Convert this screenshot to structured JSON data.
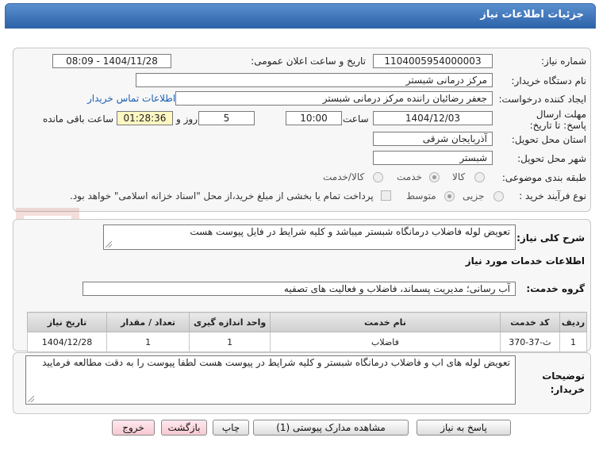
{
  "window": {
    "title": "جزئیات اطلاعات نیاز"
  },
  "form": {
    "need_number": {
      "label": "شماره نیاز:",
      "value": "1104005954000003"
    },
    "announce_datetime": {
      "label": "تاریخ و ساعت اعلان عمومی:",
      "value": "1404/11/28 - 08:09"
    },
    "buyer_org": {
      "label": "نام دستگاه خریدار:",
      "value": "مرکز درمانی شبستر"
    },
    "requester": {
      "label": "ایجاد کننده درخواست:",
      "value": "جعفر رضائیان راننده مرکز درمانی شبستر",
      "contact_link": "اطلاعات تماس خریدار"
    },
    "deadline": {
      "label": "مهلت ارسال پاسخ: تا تاریخ:",
      "date": "1404/12/03",
      "time_label": "ساعت",
      "time": "10:00",
      "days": "5",
      "days_label": "روز و",
      "remaining": "01:28:36",
      "remaining_label": "ساعت باقی مانده"
    },
    "province": {
      "label": "استان محل تحویل:",
      "value": "آذربایجان شرقی"
    },
    "city": {
      "label": "شهر محل تحویل:",
      "value": "شبستر"
    },
    "category": {
      "label": "طبقه بندی موضوعی:",
      "options": [
        "کالا",
        "خدمت",
        "کالا/خدمت"
      ],
      "selected": "خدمت"
    },
    "purchase_type": {
      "label": "نوع فرآیند خرید :",
      "options": [
        "جزیی",
        "متوسط"
      ],
      "selected": "متوسط",
      "note": "پرداخت تمام یا بخشی از مبلغ خرید،از محل \"اسناد خزانه اسلامی\" خواهد بود."
    }
  },
  "summary": {
    "label": "شرح کلی نیاز:",
    "value": "تعویض لوله فاضلاب درمانگاه شبستر میباشد و کلیه شرایط در فایل پیوست هست"
  },
  "services": {
    "section_title": "اطلاعات خدمات مورد نیاز",
    "group_label": "گروه خدمت:",
    "group_value": "آب رسانی؛ مدیریت پسماند، فاضلاب و فعالیت های تصفیه",
    "columns": [
      "ردیف",
      "کد خدمت",
      "نام خدمت",
      "واحد اندازه گیری",
      "تعداد / مقدار",
      "تاریخ نیاز"
    ],
    "rows": [
      [
        "1",
        "ث-37-370",
        "فاضلاب",
        "1",
        "1",
        "1404/12/28"
      ]
    ]
  },
  "buyer_notes": {
    "label": "توضیحات خریدار:",
    "value": "تعویض لوله های اب و فاضلاب درمانگاه شبستر و کلیه شرایط در پیوست هست لطفا پیوست را به دقت مطالعه فرمایید"
  },
  "buttons": {
    "reply": "پاسخ به نیاز",
    "attachments": "مشاهده مدارک پیوستی (1)",
    "print": "چاپ",
    "back": "بازگشت",
    "exit": "خروج"
  },
  "watermark": {
    "text": "AriaTender.net"
  },
  "colors": {
    "titlebar": "#2d63a8",
    "link": "#1a5fb4",
    "remaining_bg": "#fff7c2",
    "watermark": "#c0392b"
  }
}
